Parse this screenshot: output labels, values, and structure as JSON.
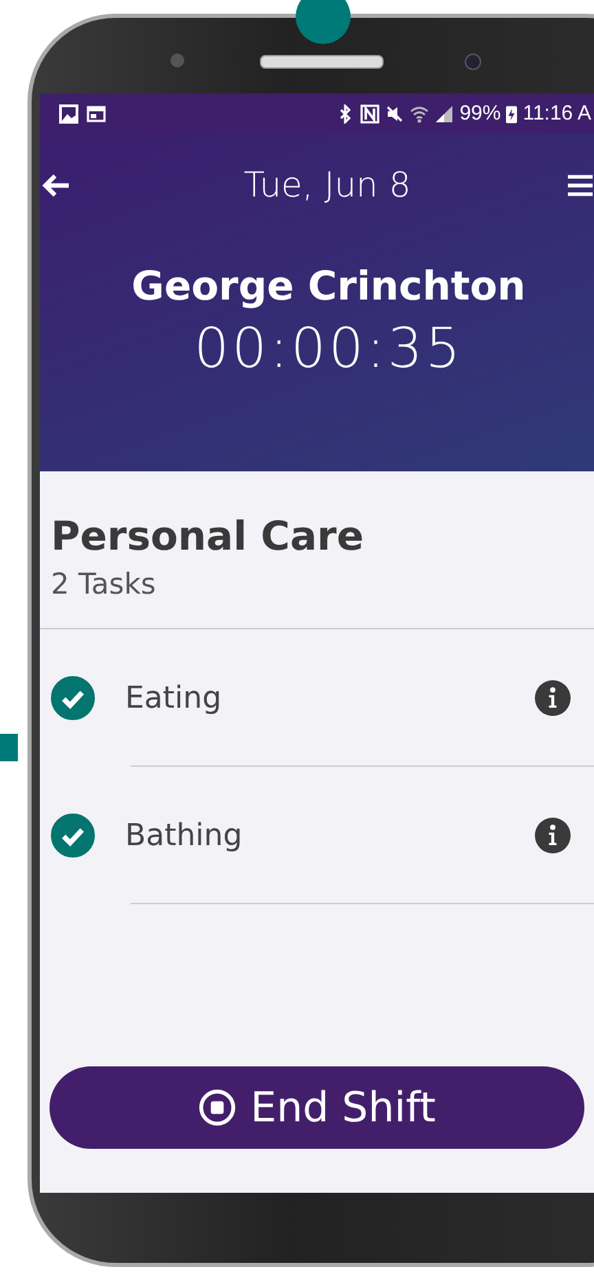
{
  "status_bar": {
    "battery": "99%",
    "time": "11:16 A"
  },
  "header": {
    "date": "Tue, Jun 8",
    "client_name": "George Crinchton",
    "timer": "00:00:35"
  },
  "section": {
    "title": "Personal Care",
    "count": "2 Tasks"
  },
  "tasks": [
    {
      "label": "Eating",
      "checked": true
    },
    {
      "label": "Bathing",
      "checked": true
    }
  ],
  "end_button": {
    "label": "End Shift"
  }
}
